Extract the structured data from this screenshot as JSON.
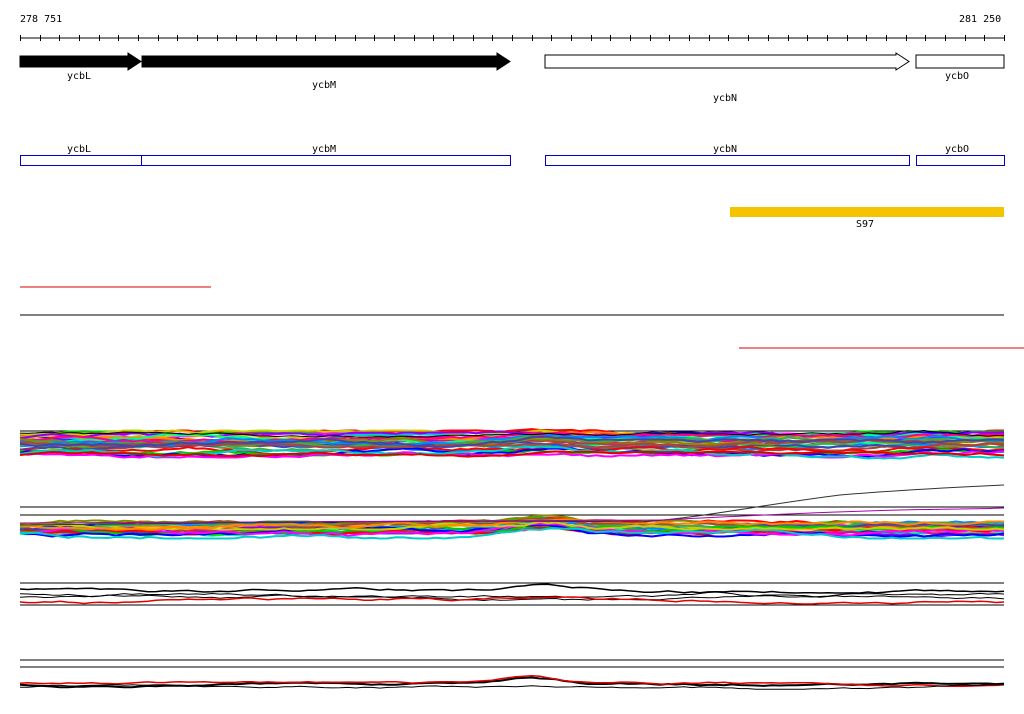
{
  "coordinates": {
    "start": "278 751",
    "end": "281 250"
  },
  "genes": [
    {
      "name": "ycbL",
      "strand": "forward",
      "fill": "#000000"
    },
    {
      "name": "ycbM",
      "strand": "forward",
      "fill": "#000000"
    },
    {
      "name": "ycbN",
      "strand": "forward",
      "fill": "#ffffff"
    },
    {
      "name": "ycbO",
      "strand": "forward",
      "fill": "#ffffff"
    }
  ],
  "cds_track": {
    "color": "#0000cc",
    "labels": [
      "ycbL",
      "ycbM",
      "ycbN",
      "ycbO"
    ]
  },
  "feature": {
    "label": "S97",
    "color": "#f5c400"
  },
  "colors": {
    "red_line": "#e00000",
    "baseline": "#000000"
  }
}
